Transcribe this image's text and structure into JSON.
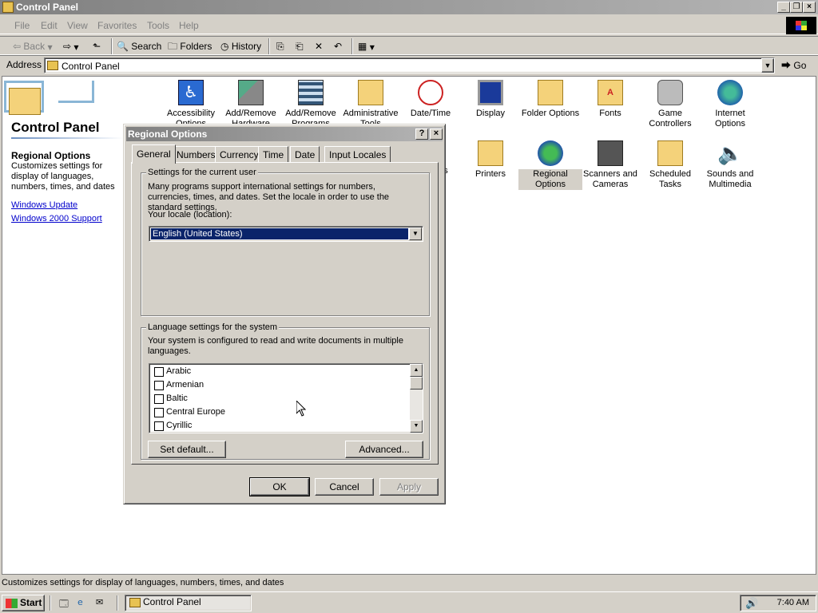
{
  "window": {
    "title": "Control Panel"
  },
  "menu": [
    "File",
    "Edit",
    "View",
    "Favorites",
    "Tools",
    "Help"
  ],
  "toolbar": {
    "back": "Back",
    "search": "Search",
    "folders": "Folders",
    "history": "History"
  },
  "address": {
    "label": "Address",
    "value": "Control Panel",
    "go": "Go"
  },
  "sidebar": {
    "title": "Control Panel",
    "selected_title": "Regional Options",
    "selected_desc": "Customizes settings for display of languages, numbers, times, and dates",
    "links": [
      "Windows Update",
      "Windows 2000 Support"
    ]
  },
  "icons_row1": [
    {
      "label": "Accessibility Options",
      "icon": "accessibility-icon"
    },
    {
      "label": "Add/Remove Hardware",
      "icon": "add-hardware-icon"
    },
    {
      "label": "Add/Remove Programs",
      "icon": "add-programs-icon"
    },
    {
      "label": "Administrative Tools",
      "icon": "admin-tools-icon"
    },
    {
      "label": "Date/Time",
      "icon": "clock-icon"
    },
    {
      "label": "Display",
      "icon": "display-icon"
    },
    {
      "label": "Folder Options",
      "icon": "folder-options-icon"
    },
    {
      "label": "Fonts",
      "icon": "fonts-icon"
    },
    {
      "label": "Game Controllers",
      "icon": "joystick-icon"
    },
    {
      "label": "Internet Options",
      "icon": "globe-icon"
    }
  ],
  "icons_row2": [
    {
      "label": "ons",
      "icon": "partial-icon"
    },
    {
      "label": "Printers",
      "icon": "printer-icon"
    },
    {
      "label": "Regional Options",
      "icon": "globe-icon"
    },
    {
      "label": "Scanners and Cameras",
      "icon": "scanner-icon"
    },
    {
      "label": "Scheduled Tasks",
      "icon": "tasks-icon"
    },
    {
      "label": "Sounds and Multimedia",
      "icon": "speaker-icon"
    }
  ],
  "status": {
    "text": "Customizes settings for display of languages, numbers, times, and dates"
  },
  "taskbar": {
    "start": "Start",
    "task": "Control Panel",
    "clock": "7:40 AM"
  },
  "dialog": {
    "title": "Regional Options",
    "tabs": [
      "General",
      "Numbers",
      "Currency",
      "Time",
      "Date",
      "Input Locales"
    ],
    "user_group": {
      "legend": "Settings for the current user",
      "desc": "Many programs support international settings for numbers, currencies, times, and dates. Set the locale in order to use the standard settings.",
      "locale_label": "Your locale (location):",
      "locale_value": "English (United States)"
    },
    "system_group": {
      "legend": "Language settings for the system",
      "desc": "Your system is configured to read and write documents in multiple languages.",
      "languages": [
        "Arabic",
        "Armenian",
        "Baltic",
        "Central Europe",
        "Cyrillic"
      ]
    },
    "buttons": {
      "set_default": "Set default...",
      "advanced": "Advanced...",
      "ok": "OK",
      "cancel": "Cancel",
      "apply": "Apply"
    }
  },
  "colors": {
    "title_gradient_start": "#808080",
    "selection": "#0a246a",
    "link": "#0000cc"
  }
}
